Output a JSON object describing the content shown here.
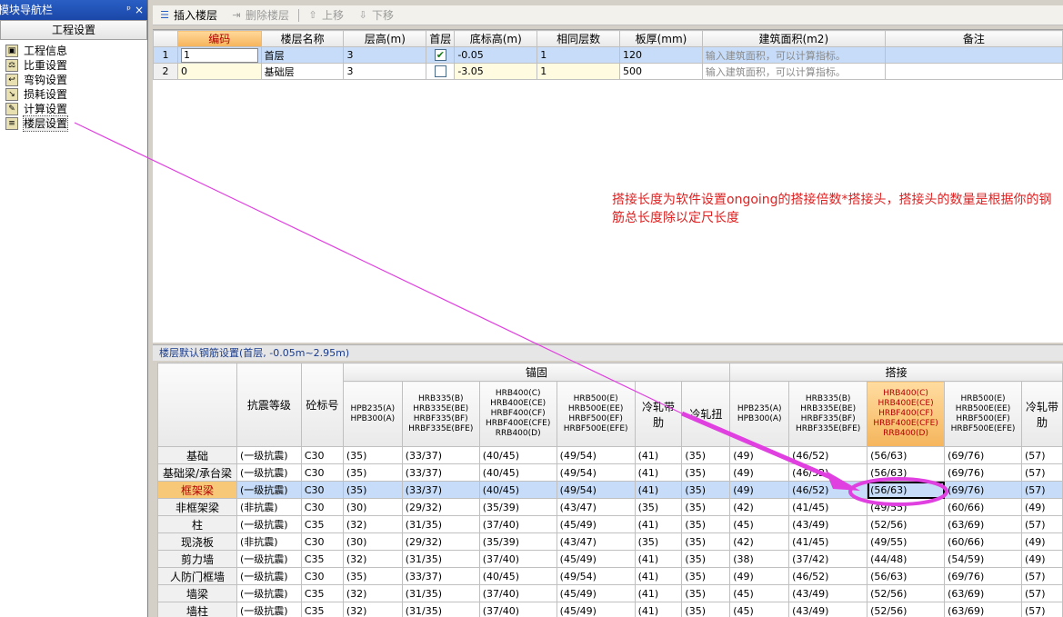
{
  "nav": {
    "title": "模块导航栏",
    "pin_symbol": "ᵖ",
    "close_symbol": "×",
    "section": "工程设置",
    "items": [
      {
        "label": "工程信息",
        "icon": "folder-icon"
      },
      {
        "label": "比重设置",
        "icon": "weight-icon"
      },
      {
        "label": "弯钩设置",
        "icon": "hook-icon"
      },
      {
        "label": "损耗设置",
        "icon": "loss-icon"
      },
      {
        "label": "计算设置",
        "icon": "calc-icon"
      },
      {
        "label": "楼层设置",
        "icon": "floor-icon",
        "selected": true
      }
    ]
  },
  "toolbar": {
    "insert": "插入楼层",
    "delete": "删除楼层",
    "up": "上移",
    "down": "下移"
  },
  "floor_table": {
    "headers": [
      "编码",
      "楼层名称",
      "层高(m)",
      "首层",
      "底标高(m)",
      "相同层数",
      "板厚(mm)",
      "建筑面积(m2)",
      "备注"
    ],
    "rows": [
      {
        "num": "1",
        "code": "1",
        "name": "首层",
        "height": "3",
        "first": true,
        "base": "-0.05",
        "same": "1",
        "thick": "120",
        "area": "输入建筑面积，可以计算指标。",
        "note": ""
      },
      {
        "num": "2",
        "code": "0",
        "name": "基础层",
        "height": "3",
        "first": false,
        "base": "-3.05",
        "same": "1",
        "thick": "500",
        "area": "输入建筑面积，可以计算指标。",
        "note": ""
      }
    ]
  },
  "annotation": "搭接长度为软件设置ongoing的搭接倍数*搭接头，搭接头的数量是根据你的钢筋总长度除以定尺长度",
  "rebar": {
    "title": "楼层默认钢筋设置(首层, -0.05m~2.95m)",
    "group_anchor": "锚固",
    "group_lap": "搭接",
    "col_seismic": "抗震等级",
    "col_concrete": "砼标号",
    "steel_headers": [
      "HPB235(A)\nHPB300(A)",
      "HRB335(B)\nHRB335E(BE)\nHRBF335(BF)\nHRBF335E(BFE)",
      "HRB400(C)\nHRB400E(CE)\nHRBF400(CF)\nHRBF400E(CFE)\nRRB400(D)",
      "HRB500(E)\nHRB500E(EE)\nHRBF500(EF)\nHRBF500E(EFE)",
      "冷轧带肋",
      "冷轧扭"
    ],
    "lap_headers": [
      "HPB235(A)\nHPB300(A)",
      "HRB335(B)\nHRB335E(BE)\nHRBF335(BF)\nHRBF335E(BFE)",
      "HRB400(C)\nHRB400E(CE)\nHRBF400(CF)\nHRBF400E(CFE)\nRRB400(D)",
      "HRB500(E)\nHRB500E(EE)\nHRBF500(EF)\nHRBF500E(EFE)",
      "冷轧带肋"
    ],
    "rows": [
      {
        "name": "基础",
        "seismic": "(一级抗震)",
        "concrete": "C30",
        "anchor": [
          "(35)",
          "(33/37)",
          "(40/45)",
          "(49/54)",
          "(41)",
          "(35)"
        ],
        "lap": [
          "(49)",
          "(46/52)",
          "(56/63)",
          "(69/76)",
          "(57)"
        ]
      },
      {
        "name": "基础梁/承台梁",
        "seismic": "(一级抗震)",
        "concrete": "C30",
        "anchor": [
          "(35)",
          "(33/37)",
          "(40/45)",
          "(49/54)",
          "(41)",
          "(35)"
        ],
        "lap": [
          "(49)",
          "(46/52)",
          "(56/63)",
          "(69/76)",
          "(57)"
        ]
      },
      {
        "name": "框架梁",
        "seismic": "(一级抗震)",
        "concrete": "C30",
        "anchor": [
          "(35)",
          "(33/37)",
          "(40/45)",
          "(49/54)",
          "(41)",
          "(35)"
        ],
        "lap": [
          "(49)",
          "(46/52)",
          "(56/63)",
          "(69/76)",
          "(57)"
        ],
        "selected": true
      },
      {
        "name": "非框架梁",
        "seismic": "(非抗震)",
        "concrete": "C30",
        "anchor": [
          "(30)",
          "(29/32)",
          "(35/39)",
          "(43/47)",
          "(35)",
          "(35)"
        ],
        "lap": [
          "(42)",
          "(41/45)",
          "(49/55)",
          "(60/66)",
          "(49)"
        ]
      },
      {
        "name": "柱",
        "seismic": "(一级抗震)",
        "concrete": "C35",
        "anchor": [
          "(32)",
          "(31/35)",
          "(37/40)",
          "(45/49)",
          "(41)",
          "(35)"
        ],
        "lap": [
          "(45)",
          "(43/49)",
          "(52/56)",
          "(63/69)",
          "(57)"
        ]
      },
      {
        "name": "现浇板",
        "seismic": "(非抗震)",
        "concrete": "C30",
        "anchor": [
          "(30)",
          "(29/32)",
          "(35/39)",
          "(43/47)",
          "(35)",
          "(35)"
        ],
        "lap": [
          "(42)",
          "(41/45)",
          "(49/55)",
          "(60/66)",
          "(49)"
        ]
      },
      {
        "name": "剪力墙",
        "seismic": "(一级抗震)",
        "concrete": "C35",
        "anchor": [
          "(32)",
          "(31/35)",
          "(37/40)",
          "(45/49)",
          "(41)",
          "(35)"
        ],
        "lap": [
          "(38)",
          "(37/42)",
          "(44/48)",
          "(54/59)",
          "(49)"
        ]
      },
      {
        "name": "人防门框墙",
        "seismic": "(一级抗震)",
        "concrete": "C30",
        "anchor": [
          "(35)",
          "(33/37)",
          "(40/45)",
          "(49/54)",
          "(41)",
          "(35)"
        ],
        "lap": [
          "(49)",
          "(46/52)",
          "(56/63)",
          "(69/76)",
          "(57)"
        ]
      },
      {
        "name": "墙梁",
        "seismic": "(一级抗震)",
        "concrete": "C35",
        "anchor": [
          "(32)",
          "(31/35)",
          "(37/40)",
          "(45/49)",
          "(41)",
          "(35)"
        ],
        "lap": [
          "(45)",
          "(43/49)",
          "(52/56)",
          "(63/69)",
          "(57)"
        ]
      },
      {
        "name": "墙柱",
        "seismic": "(一级抗震)",
        "concrete": "C35",
        "anchor": [
          "(32)",
          "(31/35)",
          "(37/40)",
          "(45/49)",
          "(41)",
          "(35)"
        ],
        "lap": [
          "(45)",
          "(43/49)",
          "(52/56)",
          "(63/69)",
          "(57)"
        ]
      }
    ]
  },
  "colors": {
    "annotation": "#e02020",
    "arrow": "#e040e0",
    "selection": "#c6dcf8",
    "highlight": "#f5b55c"
  }
}
